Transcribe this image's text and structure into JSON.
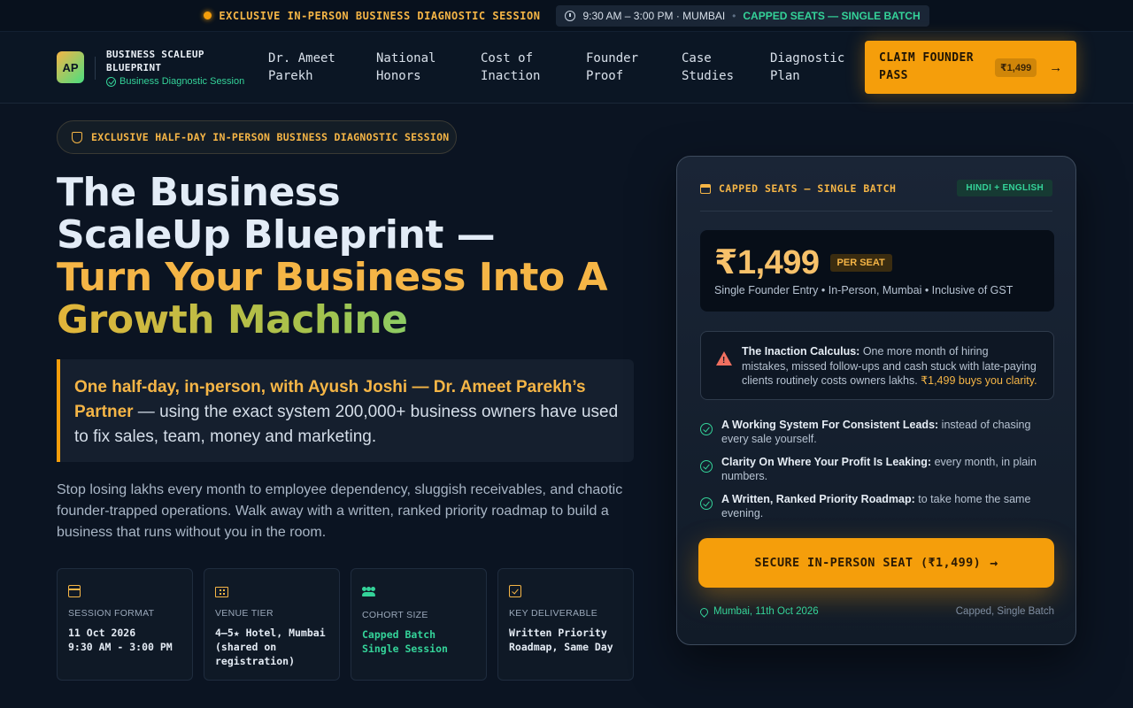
{
  "topbar": {
    "promo": "EXCLUSIVE IN-PERSON BUSINESS DIAGNOSTIC SESSION",
    "time": "9:30 AM – 3:00 PM · MUMBAI",
    "sep": "•",
    "seats": "CAPPED SEATS — SINGLE BATCH"
  },
  "nav": {
    "logo": "AP",
    "brand_line1": "BUSINESS SCALEUP",
    "brand_line2": "BLUEPRINT",
    "brand_sub": "Business Diagnostic Session",
    "links": [
      {
        "line1": "Dr. Ameet",
        "line2": "Parekh"
      },
      {
        "line1": "National",
        "line2": "Honors"
      },
      {
        "line1": "Cost of",
        "line2": "Inaction"
      },
      {
        "line1": "Founder",
        "line2": "Proof"
      },
      {
        "line1": "Case",
        "line2": "Studies"
      },
      {
        "line1": "Diagnostic",
        "line2": "Plan"
      }
    ],
    "cta_line1": "CLAIM FOUNDER",
    "cta_line2": "PASS",
    "cta_price": "₹1,499",
    "cta_arrow": "→"
  },
  "hero": {
    "pill": "EXCLUSIVE HALF-DAY IN-PERSON BUSINESS DIAGNOSTIC SESSION",
    "title_line1": "The Business",
    "title_line2": "ScaleUp Blueprint —",
    "title_line3": "Turn Your Business Into A",
    "title_line4": "Growth Machine",
    "quote_highlight": "One half-day, in-person, with Ayush Joshi — Dr. Ameet Parekh’s Partner",
    "quote_rest": " — using the exact system 200,000+ business owners have used to fix sales, team, money and marketing.",
    "paragraph": "Stop losing lakhs every month to employee dependency, sluggish receivables, and chaotic founder-trapped operations. Walk away with a written, ranked priority roadmap to build a business that runs without you in the room."
  },
  "stats": [
    {
      "icon": "calendar-icon",
      "caption": "SESSION FORMAT",
      "line1": "11 Oct 2026",
      "line2": "9:30 AM - 3:00 PM",
      "line3": "",
      "green": false
    },
    {
      "icon": "building-icon",
      "caption": "VENUE TIER",
      "line1": "4–5★ Hotel, Mumbai",
      "line2": "(shared on",
      "line3": "registration)",
      "green": false
    },
    {
      "icon": "people-icon",
      "caption": "COHORT SIZE",
      "line1": "Capped Batch",
      "line2": "Single Session",
      "line3": "",
      "green": true
    },
    {
      "icon": "checklist-icon",
      "caption": "KEY DELIVERABLE",
      "line1": "Written Priority",
      "line2": "Roadmap, Same Day",
      "line3": "",
      "green": false
    }
  ],
  "card": {
    "head_title": "CAPPED SEATS — SINGLE BATCH",
    "lang": "HINDI + ENGLISH",
    "price": "₹1,499",
    "per": "PER SEAT",
    "price_meta": "Single Founder Entry • In-Person, Mumbai • Inclusive of GST",
    "warn_bold": "The Inaction Calculus:",
    "warn_text": " One more month of hiring mistakes, missed follow-ups and cash stuck with late-paying clients routinely costs owners lakhs. ",
    "warn_orange": "₹1,499 buys you clarity.",
    "benefits": [
      {
        "bold": "A Working System For Consistent Leads:",
        "text": " instead of chasing every sale yourself."
      },
      {
        "bold": "Clarity On Where Your Profit Is Leaking:",
        "text": " every month, in plain numbers."
      },
      {
        "bold": "A Written, Ranked Priority Roadmap:",
        "text": " to take home the same evening."
      }
    ],
    "cta": "SECURE IN-PERSON SEAT (₹1,499)",
    "cta_arrow": "→",
    "foot_loc": "Mumbai, 11th Oct 2026",
    "foot_cap": "Capped, Single Batch"
  },
  "colors": {
    "accent": "#f59e0b",
    "green": "#34d399",
    "background": "#0b1422"
  }
}
